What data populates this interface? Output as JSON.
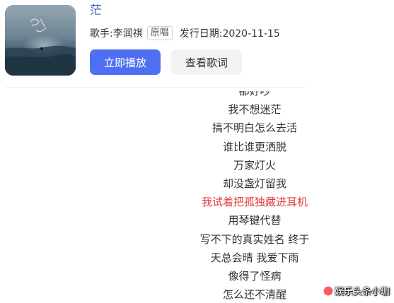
{
  "song": {
    "title": "茫",
    "singer_label": "歌手:李润祺",
    "original_badge": "原唱",
    "release_label": "发行日期:2020-11-15"
  },
  "buttons": {
    "play": "立即播放",
    "view_lyrics": "查看歌词"
  },
  "lyrics": {
    "lines": [
      "都好吵",
      "我不想迷茫",
      "搞不明白怎么去活",
      "谁比谁更洒脱",
      "万家灯火",
      "却没盏灯留我",
      "我试着把孤独藏进耳机",
      "用琴键代替",
      "写不下的真实姓名 终于",
      "天总会晴 我爱下雨",
      "像得了怪病",
      "怎么还不清醒"
    ],
    "active_index": 6
  },
  "colors": {
    "title": "#3a5fb8",
    "play_button": "#4e6ff2",
    "active_lyric": "#e43d3d"
  },
  "watermark": {
    "text": "娱乐头条小珈"
  }
}
